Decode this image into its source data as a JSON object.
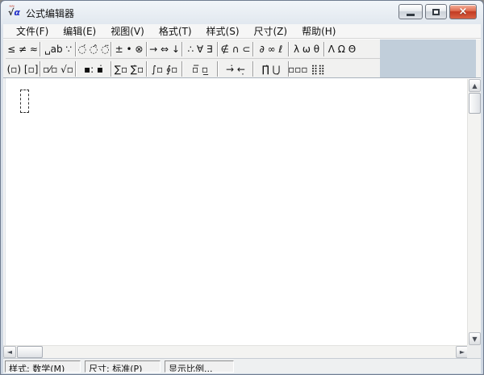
{
  "window": {
    "title": "公式编辑器"
  },
  "menu": {
    "items": [
      "文件(F)",
      "编辑(E)",
      "视图(V)",
      "格式(T)",
      "样式(S)",
      "尺寸(Z)",
      "帮助(H)"
    ]
  },
  "toolbar": {
    "row1": [
      {
        "name": "relational-symbols-palette",
        "glyphs": "≤ ≠ ≈"
      },
      {
        "name": "spaces-ellipses-palette",
        "glyphs": "␣ab ∵"
      },
      {
        "name": "embellishments-palette",
        "glyphs": "◌́ ◌̂ ◌̈"
      },
      {
        "name": "operator-symbols-palette",
        "glyphs": "± • ⊗"
      },
      {
        "name": "arrow-symbols-palette",
        "glyphs": "→ ⇔ ↓"
      },
      {
        "name": "logical-symbols-palette",
        "glyphs": "∴ ∀ ∃"
      },
      {
        "name": "set-theory-symbols-palette",
        "glyphs": "∉ ∩ ⊂"
      },
      {
        "name": "misc-symbols-palette",
        "glyphs": "∂ ∞ ℓ"
      },
      {
        "name": "greek-lowercase-palette",
        "glyphs": "λ ω θ"
      },
      {
        "name": "greek-uppercase-palette",
        "glyphs": "Λ Ω Θ"
      }
    ],
    "row2": [
      {
        "name": "fence-templates-palette",
        "glyphs": "(▫) [▫]"
      },
      {
        "name": "fraction-radical-templates-palette",
        "glyphs": "▫⁄▫ √▫"
      },
      {
        "name": "subscript-superscript-templates-palette",
        "glyphs": "▪: ▪̇"
      },
      {
        "name": "summation-templates-palette",
        "glyphs": "∑▫ ∑̇▫"
      },
      {
        "name": "integral-templates-palette",
        "glyphs": "∫▫ ∮▫"
      },
      {
        "name": "bar-templates-palette",
        "glyphs": "▫̅ ▫̲"
      },
      {
        "name": "labeled-arrow-templates-palette",
        "glyphs": "→̇ ←̣"
      },
      {
        "name": "product-set-templates-palette",
        "glyphs": "∏̇ ⋃̣"
      },
      {
        "name": "matrix-templates-palette",
        "glyphs": "▫▫▫ ⣿⣿"
      }
    ]
  },
  "statusbar": {
    "style": "样式: 数学(M)",
    "size": "尺寸: 标准(P)",
    "zoom": "显示比例..."
  }
}
